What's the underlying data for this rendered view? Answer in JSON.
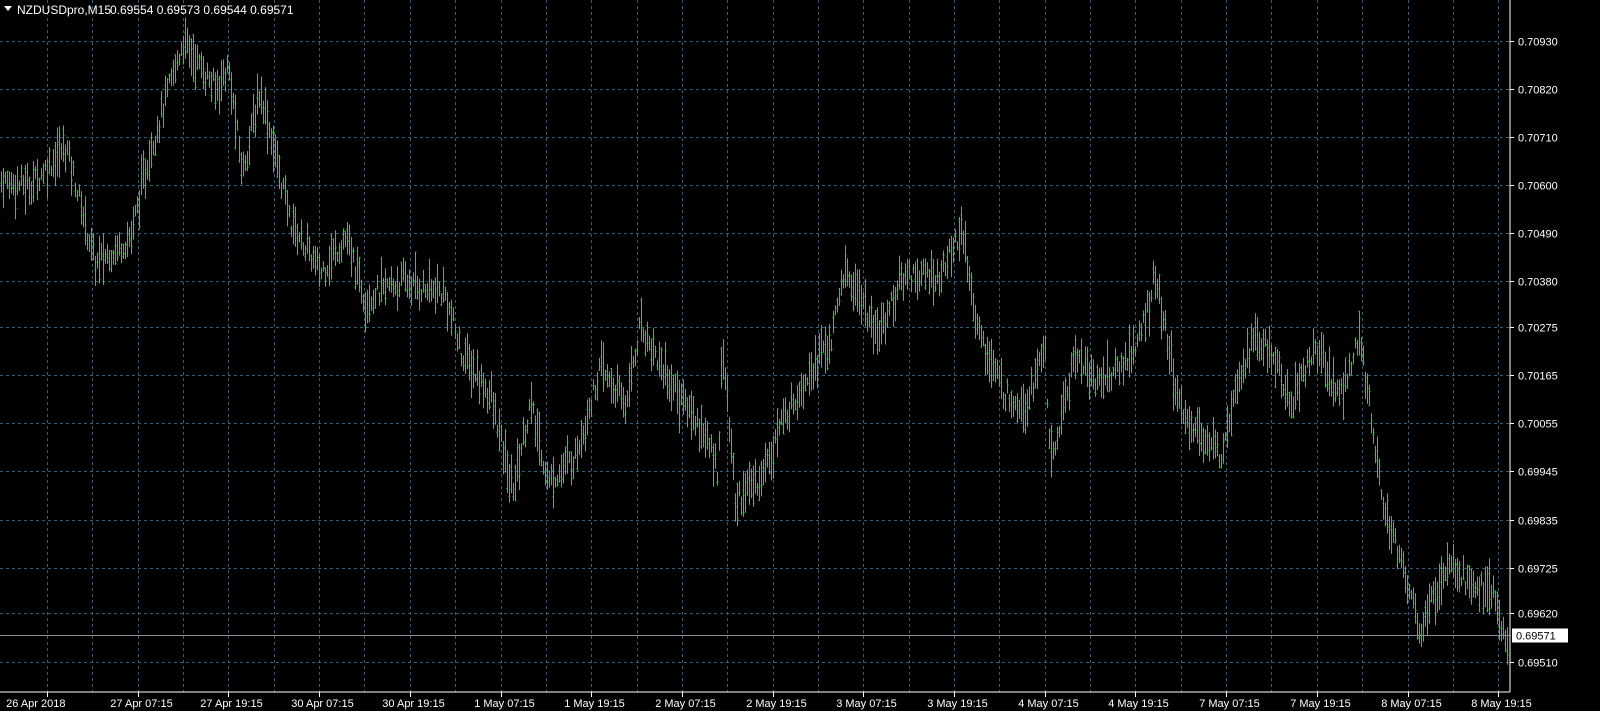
{
  "header": {
    "arrow_icon": "triangle-down-icon",
    "symbol": "NZDUSDpro,M15",
    "ohlc": "0.69554 0.69573 0.69544 0.69571"
  },
  "colors": {
    "background": "#000000",
    "grid": "#3a5a73",
    "bars": "#00ee00",
    "axis_text": "#ffffff",
    "current_price_line": "#8c8c8c"
  },
  "chart_data": {
    "type": "line",
    "title": "NZDUSDpro,M15",
    "xlabel": "",
    "ylabel": "",
    "grid": true,
    "ylim": [
      0.6947,
      0.7104
    ],
    "y_ticks": [
      "0.70930",
      "0.70820",
      "0.70710",
      "0.70600",
      "0.70490",
      "0.70380",
      "0.70275",
      "0.70165",
      "0.70055",
      "0.69945",
      "0.69835",
      "0.69725",
      "0.69620",
      "0.69510"
    ],
    "x_ticks": [
      "26 Apr 2018",
      "27 Apr 07:15",
      "27 Apr 19:15",
      "30 Apr 07:15",
      "30 Apr 19:15",
      "1 May 07:15",
      "1 May 19:15",
      "2 May 07:15",
      "2 May 19:15",
      "3 May 07:15",
      "3 May 19:15",
      "4 May 07:15",
      "4 May 19:15",
      "7 May 07:15",
      "7 May 19:15",
      "8 May 07:15",
      "8 May 19:15"
    ],
    "current_price": "0.69571",
    "series": [
      {
        "x": [
          "26 Apr 2018",
          "27 Apr 07:15",
          "27 Apr 19:15",
          "30 Apr 07:15",
          "30 Apr 19:15",
          "1 May 07:15",
          "1 May 19:15",
          "2 May 07:15",
          "2 May 19:15",
          "3 May 07:15",
          "3 May 19:15",
          "4 May 07:15",
          "4 May 19:15",
          "7 May 07:15",
          "7 May 19:15",
          "8 May 07:15",
          "8 May 19:15"
        ],
        "values": [
          0.7062,
          0.705,
          0.7082,
          0.7048,
          0.7031,
          0.7007,
          0.7011,
          0.7022,
          0.699,
          0.703,
          0.704,
          0.7005,
          0.7018,
          0.702,
          0.7022,
          0.6972,
          0.6955
        ],
        "extra_points": [
          [
            "27 Apr 2018 12:00",
            0.7093
          ],
          [
            "28 Apr 00:00",
            0.708
          ],
          [
            "1 May 13:00",
            0.6988
          ],
          [
            "2 May 22:00",
            0.6984
          ],
          [
            "3 May 22:00",
            0.7049
          ],
          [
            "4 May 13:00",
            0.6992
          ],
          [
            "5 May 04:00",
            0.7039
          ],
          [
            "7 May 13:00",
            0.6995
          ],
          [
            "8 May 01:00",
            0.7028
          ],
          [
            "8 May 12:00",
            0.6958
          ],
          [
            "8 May 14:00",
            0.6972
          ],
          [
            "9 May 00:00",
            0.6957
          ]
        ]
      }
    ]
  }
}
